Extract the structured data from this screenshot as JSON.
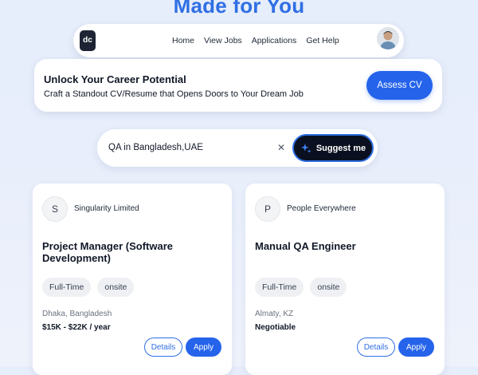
{
  "hero": {
    "title": "Made for You"
  },
  "navbar": {
    "logo_text": "dc",
    "links": [
      "Home",
      "View Jobs",
      "Applications",
      "Get Help"
    ]
  },
  "cv_banner": {
    "title": "Unlock Your Career Potential",
    "subtitle": "Craft a Standout CV/Resume that Opens Doors to Your Dream Job",
    "button_label": "Assess CV"
  },
  "search": {
    "value": "QA in Bangladesh,UAE",
    "clear_icon": "close-icon",
    "suggest_label": "Suggest me",
    "suggest_icon": "sparkle-icon"
  },
  "jobs": [
    {
      "company_initial": "S",
      "company": "Singularity Limited",
      "title": "Project Manager (Software Development)",
      "tags": [
        "Full-Time",
        "onsite"
      ],
      "location": "Dhaka, Bangladesh",
      "salary": "$15K - $22K / year",
      "details_label": "Details",
      "apply_label": "Apply"
    },
    {
      "company_initial": "P",
      "company": "People Everywhere",
      "title": "Manual QA Engineer",
      "tags": [
        "Full-Time",
        "onsite"
      ],
      "location": "Almaty, KZ",
      "salary": "Negotiable",
      "details_label": "Details",
      "apply_label": "Apply"
    }
  ],
  "colors": {
    "accent": "#2563eb",
    "hero_title": "#2f6fe4",
    "dark_button": "#0b1020"
  }
}
